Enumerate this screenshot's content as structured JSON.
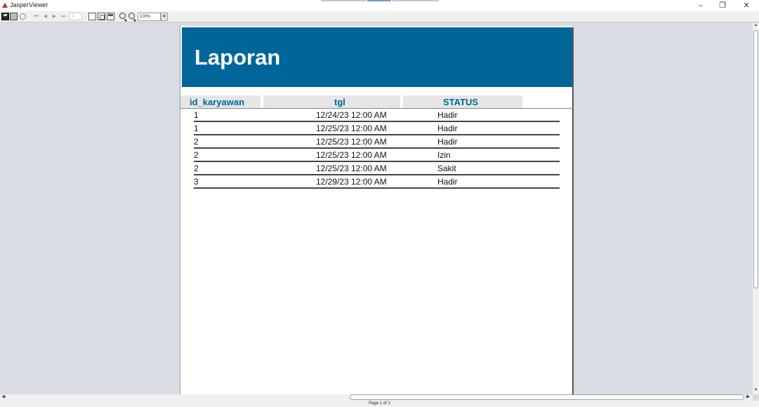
{
  "window": {
    "title": "JasperViewer",
    "minimize": "–",
    "maximize": "❐",
    "close": "✕"
  },
  "toolbar": {
    "page_number": "1",
    "zoom": "100%",
    "zoom_dropdown": "▼",
    "nav_first": "⏮",
    "nav_prev": "◀",
    "nav_next": "▶",
    "nav_last": "⏭"
  },
  "report": {
    "title": "Laporan",
    "banner_color": "#006699",
    "columns": [
      "id_karyawan",
      "tgl",
      "STATUS"
    ],
    "rows": [
      {
        "id_karyawan": "1",
        "tgl": "12/24/23 12:00 AM",
        "status": "Hadir"
      },
      {
        "id_karyawan": "1",
        "tgl": "12/25/23 12:00 AM",
        "status": "Hadir"
      },
      {
        "id_karyawan": "2",
        "tgl": "12/25/23 12:00 AM",
        "status": "Hadir"
      },
      {
        "id_karyawan": "2",
        "tgl": "12/25/23 12:00 AM",
        "status": "Izin"
      },
      {
        "id_karyawan": "2",
        "tgl": "12/25/23 12:00 AM",
        "status": "Sakit"
      },
      {
        "id_karyawan": "3",
        "tgl": "12/29/23 12:00 AM",
        "status": "Hadir"
      }
    ]
  },
  "status_bar": {
    "text": "Page 1 of 1"
  }
}
